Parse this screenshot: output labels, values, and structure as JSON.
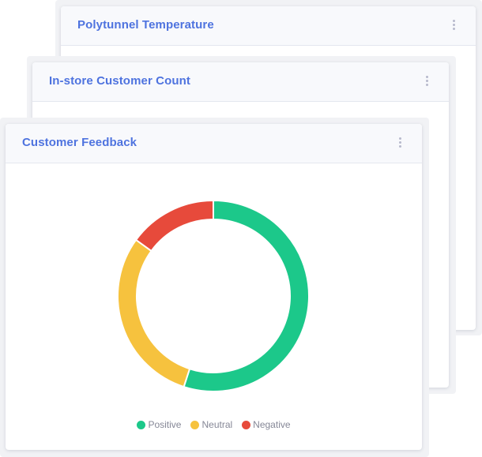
{
  "cards": {
    "polytunnel": {
      "title": "Polytunnel Temperature",
      "menu_icon": "kebab-menu-icon"
    },
    "customer_count": {
      "title": "In-store Customer Count",
      "menu_icon": "kebab-menu-icon"
    },
    "feedback": {
      "title": "Customer Feedback",
      "menu_icon": "kebab-menu-icon"
    }
  },
  "colors": {
    "accent": "#4e73df",
    "positive": "#1cc88a",
    "neutral": "#f6c23e",
    "negative": "#e74a3b"
  },
  "chart_data": {
    "type": "pie",
    "variant": "doughnut",
    "categories": [
      "Positive",
      "Neutral",
      "Negative"
    ],
    "values": [
      55,
      30,
      15
    ],
    "colors": [
      "#1cc88a",
      "#f6c23e",
      "#e74a3b"
    ],
    "legend": "bottom"
  }
}
